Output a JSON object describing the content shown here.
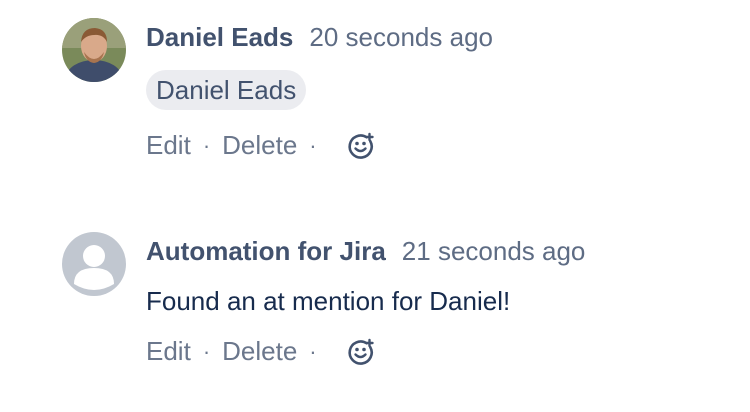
{
  "comments": [
    {
      "author": "Daniel Eads",
      "time": "20 seconds ago",
      "mention": "Daniel Eads",
      "actions": {
        "edit": "Edit",
        "separator": "·",
        "delete": "Delete"
      },
      "avatar": "user-photo-avatar"
    },
    {
      "author": "Automation for Jira",
      "time": "21 seconds ago",
      "text": "Found an at mention for Daniel!",
      "actions": {
        "edit": "Edit",
        "separator": "·",
        "delete": "Delete"
      },
      "avatar": "default-person-avatar"
    }
  ],
  "colors": {
    "author": "#42526e",
    "meta": "#6b778c",
    "mention_bg": "#ebecf0",
    "avatar_placeholder": "#c1c7d0"
  }
}
